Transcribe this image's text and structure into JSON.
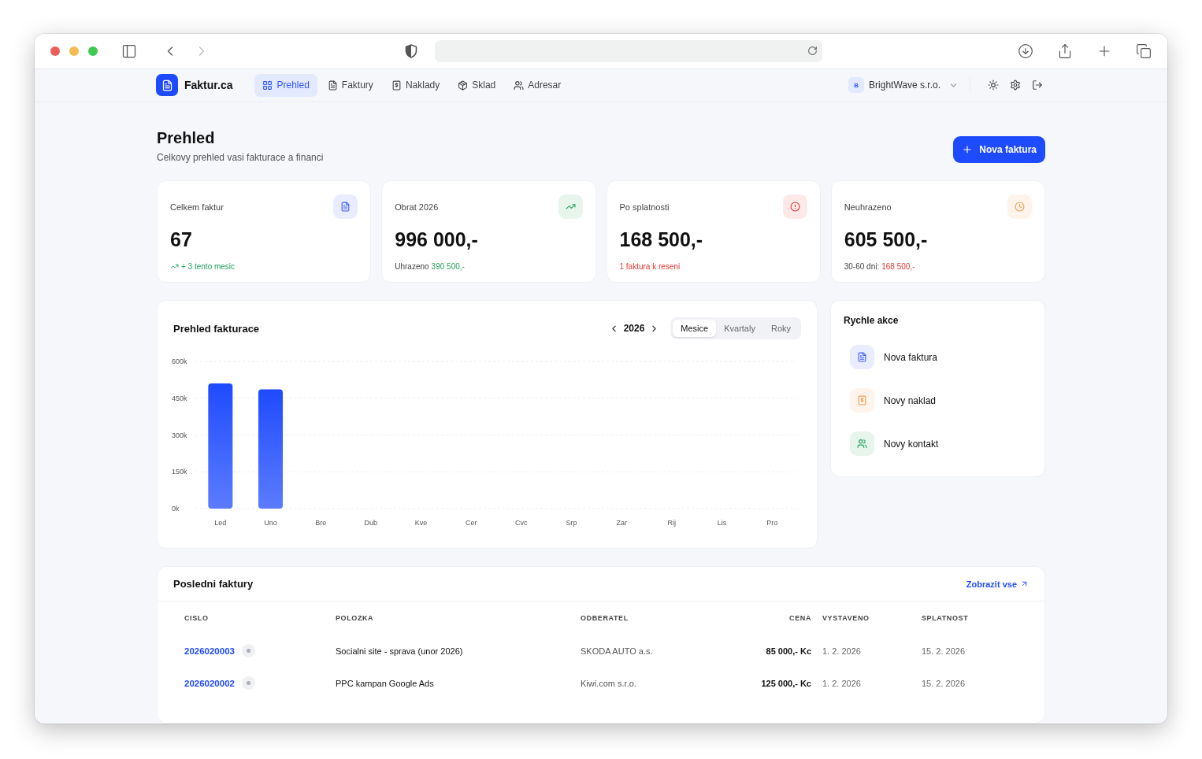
{
  "brand": {
    "name": "Faktur.ca"
  },
  "nav": [
    {
      "label": "Prehled",
      "selected": true
    },
    {
      "label": "Faktury",
      "selected": false
    },
    {
      "label": "Naklady",
      "selected": false
    },
    {
      "label": "Sklad",
      "selected": false
    },
    {
      "label": "Adresar",
      "selected": false
    }
  ],
  "company": {
    "initial": "B",
    "name": "BrightWave s.r.o."
  },
  "header": {
    "title": "Prehled",
    "subtitle": "Celkovy prehled vasi fakturace a financi",
    "action": "Nova faktura"
  },
  "stats": [
    {
      "label": "Celkem faktur",
      "value": "67",
      "kind": "count",
      "note": {
        "value": "+ 3 tento mesic",
        "kind": "positive",
        "trend": true
      }
    },
    {
      "label": "Obrat 2026",
      "value": "996 000,-",
      "kind": "revenue",
      "note": {
        "label": "Uhrazeno",
        "value": "390 500,-",
        "kind": "positive"
      }
    },
    {
      "label": "Po splatnosti",
      "value": "168 500,-",
      "kind": "overdue",
      "note": {
        "value": "1 faktura k reseni",
        "kind": "negative"
      }
    },
    {
      "label": "Neuhrazeno",
      "value": "605 500,-",
      "kind": "unpaid",
      "note": {
        "label": "30-60 dni:",
        "value": "168 500,-",
        "kind": "negative"
      }
    }
  ],
  "overview": {
    "title": "Prehled fakturace",
    "year": "2026",
    "periods": [
      {
        "label": "Mesice",
        "selected": true
      },
      {
        "label": "Kvartaly",
        "selected": false
      },
      {
        "label": "Roky",
        "selected": false
      }
    ],
    "chart_data": {
      "type": "bar",
      "categories": [
        "Led",
        "Uno",
        "Bre",
        "Dub",
        "Kve",
        "Cer",
        "Cvc",
        "Srp",
        "Zar",
        "Rij",
        "Lis",
        "Pro"
      ],
      "values": [
        510000,
        486000,
        0,
        0,
        0,
        0,
        0,
        0,
        0,
        0,
        0,
        0
      ],
      "ylim": [
        0,
        600000
      ],
      "grid": true,
      "yticks": [
        {
          "value": 0,
          "label": "0k"
        },
        {
          "value": 150000,
          "label": "150k"
        },
        {
          "value": 300000,
          "label": "300k"
        },
        {
          "value": 450000,
          "label": "450k"
        },
        {
          "value": 600000,
          "label": "600k"
        }
      ]
    }
  },
  "quick_actions": {
    "title": "Rychle akce",
    "items": [
      {
        "label": "Nova faktura",
        "kind": "invoice"
      },
      {
        "label": "Novy naklad",
        "kind": "expense"
      },
      {
        "label": "Novy kontakt",
        "kind": "contact"
      }
    ]
  },
  "invoices": {
    "title": "Posledni faktury",
    "link": "Zobrazit vse",
    "columns": [
      "CISLO",
      "POLOZKA",
      "ODBERATEL",
      "CENA",
      "VYSTAVENO",
      "SPLATNOST"
    ],
    "rows": [
      {
        "number": "2026020003",
        "item": "Socialni site - sprava (unor 2026)",
        "customer": "SKODA AUTO a.s.",
        "price": "85 000,- Kc",
        "issued": "1. 2. 2026",
        "due": "15. 2. 2026"
      },
      {
        "number": "2026020002",
        "item": "PPC kampan Google Ads",
        "customer": "Kiwi.com s.r.o.",
        "price": "125 000,- Kc",
        "issued": "1. 2. 2026",
        "due": "15. 2. 2026"
      }
    ]
  }
}
